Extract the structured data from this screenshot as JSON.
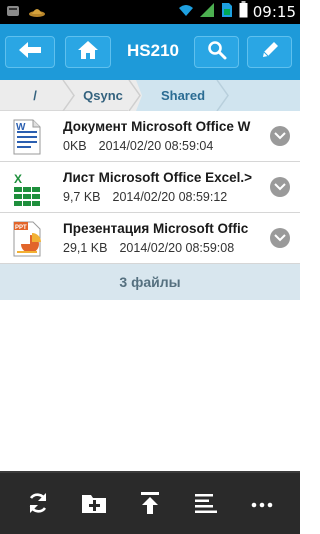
{
  "status_bar": {
    "time": "09:15",
    "icons": [
      "notification-icon",
      "hat-icon",
      "wifi-icon",
      "signal-icon",
      "sim-icon",
      "battery-icon"
    ]
  },
  "action_bar": {
    "title": "HS210",
    "buttons": [
      "back-icon",
      "home-icon",
      "search-icon",
      "edit-icon"
    ],
    "color": "#1e9ad9"
  },
  "breadcrumb": {
    "items": [
      "/",
      "Qsync",
      "Shared"
    ],
    "active_index": 2
  },
  "files": [
    {
      "name": "Документ Microsoft Office W",
      "size": "0KB",
      "date": "2014/02/20 08:59:04",
      "icon": "word-document-icon"
    },
    {
      "name": "Лист Microsoft Office Excel.>",
      "size": "9,7 KB",
      "date": "2014/02/20 08:59:12",
      "icon": "excel-spreadsheet-icon"
    },
    {
      "name": "Презентация Microsoft Offic",
      "size": "29,1 KB",
      "date": "2014/02/20 08:59:08",
      "icon": "powerpoint-presentation-icon"
    }
  ],
  "file_count": "3 файлы",
  "bottom_bar": {
    "buttons": [
      "refresh-icon",
      "new-folder-icon",
      "upload-icon",
      "sort-icon",
      "more-icon"
    ]
  },
  "colors": {
    "accent": "#1e9ad9",
    "word": "#2b5fb0",
    "excel": "#1e8f3c",
    "powerpoint": "#e2652a"
  }
}
